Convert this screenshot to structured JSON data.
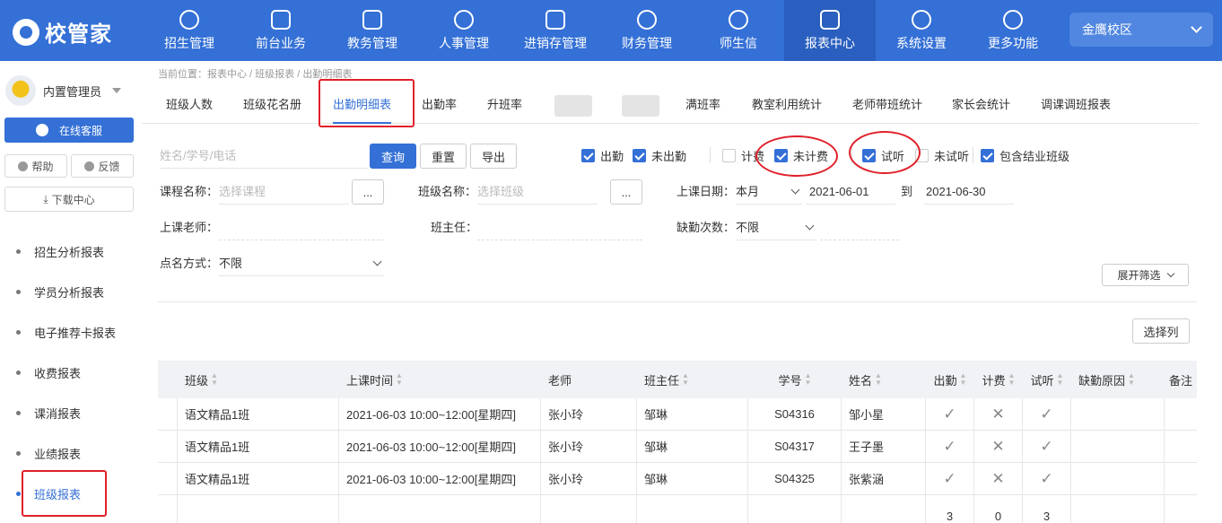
{
  "brand": {
    "name": "校管家"
  },
  "nav": [
    {
      "label": "招生管理",
      "icon": "person-add-icon"
    },
    {
      "label": "前台业务",
      "icon": "monitor-icon"
    },
    {
      "label": "教务管理",
      "icon": "book-icon"
    },
    {
      "label": "人事管理",
      "icon": "person-icon"
    },
    {
      "label": "进销存管理",
      "icon": "exchange-icon"
    },
    {
      "label": "财务管理",
      "icon": "money-icon"
    },
    {
      "label": "师生信",
      "icon": "chat-icon"
    },
    {
      "label": "报表中心",
      "icon": "report-icon",
      "active": true
    },
    {
      "label": "系统设置",
      "icon": "settings-icon"
    },
    {
      "label": "更多功能",
      "icon": "more-icon"
    }
  ],
  "campus": "金鹰校区",
  "user": {
    "name": "内置管理员"
  },
  "sidebar": {
    "service": "在线客服",
    "help": "帮助",
    "feedback": "反馈",
    "download": "下载中心",
    "menu": [
      "招生分析报表",
      "学员分析报表",
      "电子推荐卡报表",
      "收费报表",
      "课消报表",
      "业绩报表",
      "班级报表"
    ]
  },
  "breadcrumb": "当前位置：报表中心 / 班级报表 / 出勤明细表",
  "tabs": [
    "班级人数",
    "班级花名册",
    "出勤明细表",
    "出勤率",
    "升班率",
    "满班率",
    "教室利用统计",
    "老师带班统计",
    "家长会统计",
    "调课调班报表"
  ],
  "filters": {
    "search_placeholder": "姓名/学号/电话",
    "query": "查询",
    "reset": "重置",
    "export": "导出",
    "checks": [
      {
        "label": "出勤",
        "checked": true
      },
      {
        "label": "未出勤",
        "checked": true
      },
      {
        "label": "计费",
        "checked": false
      },
      {
        "label": "未计费",
        "checked": true
      },
      {
        "label": "试听",
        "checked": true
      },
      {
        "label": "未试听",
        "checked": false
      },
      {
        "label": "包含结业班级",
        "checked": true
      }
    ],
    "course_label": "课程名称：",
    "course_placeholder": "选择课程",
    "class_label": "班级名称：",
    "class_placeholder": "选择班级",
    "dots": "...",
    "date_label": "上课日期：",
    "date_range": "本月",
    "date_from": "2021-06-01",
    "date_to_label": "到",
    "date_to": "2021-06-30",
    "teacher_label": "上课老师：",
    "head_teacher_label": "班主任：",
    "absence_label": "缺勤次数：",
    "absence_value": "不限",
    "rollcall_label": "点名方式：",
    "rollcall_value": "不限",
    "expand": "展开筛选",
    "choose_columns": "选择列"
  },
  "table": {
    "headers": [
      "班级",
      "上课时间",
      "老师",
      "班主任",
      "学号",
      "姓名",
      "出勤",
      "计费",
      "试听",
      "缺勤原因",
      "备注"
    ],
    "rows": [
      {
        "class": "语文精品1班",
        "time": "2021-06-03 10:00~12:00[星期四]",
        "teacher": "张小玲",
        "head": "邹琳",
        "id": "S04316",
        "name": "邹小星",
        "attend": "✓",
        "billed": "✕",
        "trial": "✓"
      },
      {
        "class": "语文精品1班",
        "time": "2021-06-03 10:00~12:00[星期四]",
        "teacher": "张小玲",
        "head": "邹琳",
        "id": "S04317",
        "name": "王子墨",
        "attend": "✓",
        "billed": "✕",
        "trial": "✓"
      },
      {
        "class": "语文精品1班",
        "time": "2021-06-03 10:00~12:00[星期四]",
        "teacher": "张小玲",
        "head": "邹琳",
        "id": "S04325",
        "name": "张紫涵",
        "attend": "✓",
        "billed": "✕",
        "trial": "✓"
      }
    ],
    "totals": {
      "attend": "3",
      "billed": "0",
      "trial": "3"
    }
  },
  "colors": {
    "primary": "#3470d6",
    "annotation": "#e0202a"
  }
}
